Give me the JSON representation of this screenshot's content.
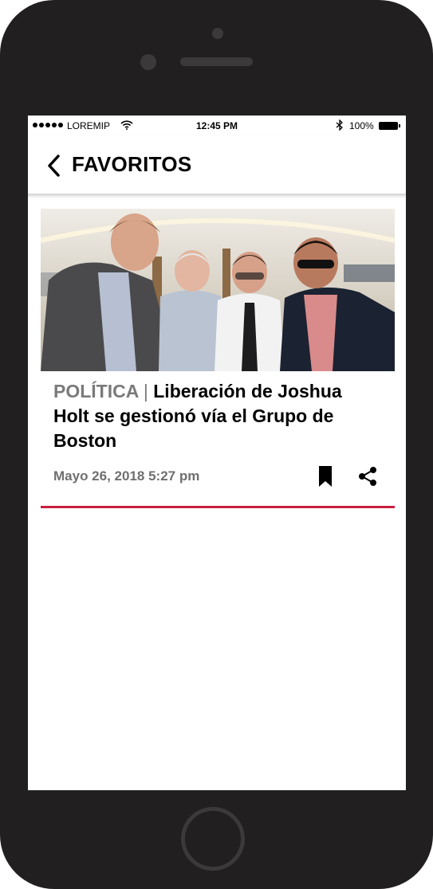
{
  "status_bar": {
    "carrier": "LOREMIP",
    "time": "12:45 PM",
    "battery": "100%",
    "icons": [
      "signal-dots-icon",
      "wifi-icon",
      "bluetooth-icon",
      "battery-icon"
    ]
  },
  "header": {
    "title": "FAVORITOS",
    "back_icon": "chevron-left-icon"
  },
  "article": {
    "category": "POLÍTICA",
    "separator": "|",
    "title": "Liberación de Joshua Holt se gestionó vía el Grupo de Boston",
    "date": "Mayo 26, 2018 5:27 pm",
    "actions": [
      "bookmark-icon",
      "share-icon"
    ],
    "accent_color": "#c9203f"
  }
}
